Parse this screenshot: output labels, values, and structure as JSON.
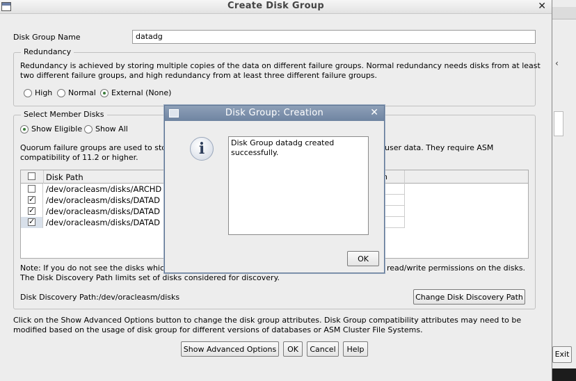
{
  "window": {
    "title": "Create Disk Group",
    "close_glyph": "✕"
  },
  "form": {
    "disk_group_name_label": "Disk Group Name",
    "disk_group_name_value": "datadg"
  },
  "redundancy": {
    "legend": "Redundancy",
    "description_line1": "Redundancy is achieved by storing multiple copies of the data on different failure groups. Normal redundancy needs disks from at least",
    "description_line2": "two different failure groups, and high redundancy from at least three different failure groups.",
    "options": [
      {
        "label": "High",
        "selected": false
      },
      {
        "label": "Normal",
        "selected": false
      },
      {
        "label": "External (None)",
        "selected": true
      }
    ]
  },
  "member_disks": {
    "legend": "Select Member Disks",
    "filter_options": [
      {
        "label": "Show Eligible",
        "selected": true
      },
      {
        "label": "Show All",
        "selected": false
      }
    ],
    "quorum_line1_left": "Quorum failure groups are used to sto",
    "quorum_line1_right": "user data. They require ASM",
    "quorum_line2": "compatibility of 11.2 or higher.",
    "table": {
      "header_path": "Disk Path",
      "header_right_fragment": "n",
      "rows": [
        {
          "path": "/dev/oracleasm/disks/ARCHD",
          "checked": false
        },
        {
          "path": "/dev/oracleasm/disks/DATAD",
          "checked": true
        },
        {
          "path": "/dev/oracleasm/disks/DATAD",
          "checked": true
        },
        {
          "path": "/dev/oracleasm/disks/DATAD",
          "checked": true
        }
      ]
    },
    "note_line1_left": "Note: If you do not see the disks which",
    "note_line1_right": "read/write permissions on the disks.",
    "note_line2": "The Disk Discovery Path limits set of disks considered for discovery.",
    "discovery_path_text": "Disk Discovery Path:/dev/oracleasm/disks",
    "change_path_button": "Change Disk Discovery Path"
  },
  "advanced_note_line1": "Click on the Show Advanced Options button to change the disk group attributes. Disk Group compatibility attributes may need to be",
  "advanced_note_line2": "modified based on the usage of disk group for different versions of databases or ASM Cluster File Systems.",
  "buttons": {
    "show_advanced": "Show Advanced Options",
    "ok": "OK",
    "cancel": "Cancel",
    "help": "Help"
  },
  "modal": {
    "title": "Disk Group: Creation",
    "close_glyph": "✕",
    "icon_glyph": "i",
    "message": "Disk Group datadg created successfully.",
    "ok_button": "OK"
  },
  "background_window": {
    "chevron_glyph": "‹",
    "exit_button": "Exit"
  }
}
